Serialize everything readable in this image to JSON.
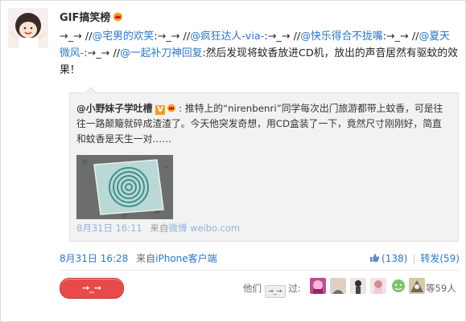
{
  "post": {
    "author": "GIF搞笑榜",
    "segments": [
      {
        "t": "→_→ //"
      },
      {
        "t": "@宅男的欢笑",
        "link": true
      },
      {
        "t": ":→_→ //"
      },
      {
        "t": "@疯狂达人-via-",
        "link": true
      },
      {
        "t": ":→_→ //"
      },
      {
        "t": "@快乐得合不拢嘴",
        "link": true
      },
      {
        "t": ":→_→ //"
      },
      {
        "t": "@夏天微风-",
        "link": true
      },
      {
        "t": ":→_→ //"
      },
      {
        "t": "@一起补刀神回复",
        "link": true
      },
      {
        "t": ":然后发现将蚊香放进CD机，放出的声音居然有驱蚊的效果！"
      }
    ],
    "time": "8月31日 16:28",
    "source_prefix": "来自",
    "source": "iPhone客户端"
  },
  "quote": {
    "author": "@小野妹子学吐槽",
    "v_badge": "V",
    "text": "推特上的“nirenbenri”同学每次出门旅游都带上蚊香，可是往往一路颠簸就碎成渣渣了。今天他突发奇想，用CD盒装了一下，竟然尺寸刚刚好，简直和蚊香是天生一对……",
    "time": "8月31日 16:11",
    "source_prefix": "来自",
    "source": "微博 weibo.com"
  },
  "actions": {
    "like_count": "(138)",
    "repost_label": "转发(59)"
  },
  "emotion": {
    "button_label": "→_→",
    "they_label": "他们",
    "mini_label": "→_→",
    "they_suffix": "过:",
    "count_label": "等59人"
  },
  "colors": {
    "link": "#2a77c9",
    "button": "#e84a4a",
    "quote_bg": "#f2f2f2"
  }
}
